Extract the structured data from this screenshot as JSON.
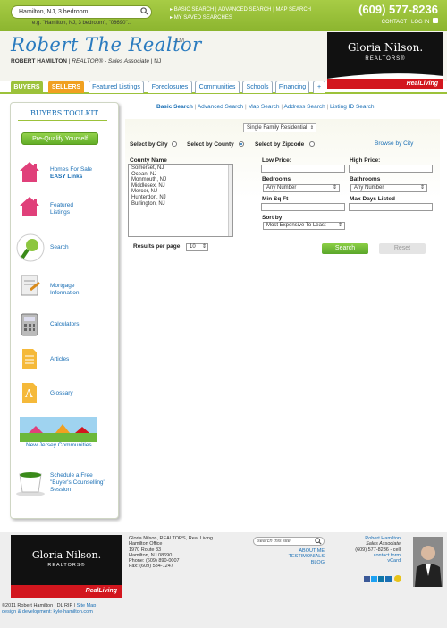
{
  "topbar": {
    "search_value": "Hamilton, NJ, 3 bedroom",
    "search_hint": "e.g. \"Hamilton, NJ, 3 bedroom\", \"08690\"...",
    "links": [
      "BASIC SEARCH",
      "ADVANCED SEARCH",
      "MAP SEARCH"
    ],
    "saved": "MY SAVED SEARCHES",
    "phone": "(609) 577-8236",
    "contact": "CONTACT",
    "login": "LOG IN"
  },
  "header": {
    "logo": "Robert The Realtor",
    "tm": "TM",
    "agent_name": "ROBERT HAMILTON",
    "agent_role": "REALTOR® - Sales Associate",
    "agent_state": "NJ",
    "brand_name": "Gloria Nilson.",
    "brand_sub": "REALTORS®",
    "brand_tag": "RealLiving"
  },
  "nav": {
    "tabs": [
      "BUYERS",
      "SELLERS",
      "Featured Listings",
      "Foreclosures",
      "Communities",
      "Schools",
      "Financing",
      "+"
    ]
  },
  "sidebar": {
    "title": "BUYERS TOOLKIT",
    "prequal": "Pre-Qualify Yourself",
    "items": [
      {
        "line1": "Homes For Sale",
        "line2": "EASY Links"
      },
      {
        "line1": "Featured",
        "line2": "Listings"
      },
      {
        "line1": "Search",
        "line2": ""
      },
      {
        "line1": "Mortgage",
        "line2": "Information"
      },
      {
        "line1": "Calculators",
        "line2": ""
      },
      {
        "line1": "Articles",
        "line2": ""
      },
      {
        "line1": "Glossary",
        "line2": ""
      },
      {
        "line1": "New Jersey Communities",
        "line2": ""
      },
      {
        "line1": "Schedule a Free",
        "line2": "\"Buyer's Counselling\"",
        "line3": "Session"
      }
    ]
  },
  "search": {
    "tabs": [
      "Basic Search",
      "Advanced Search",
      "Map Search",
      "Address Search",
      "Listing ID Search"
    ],
    "property_type": "Single Family Residential",
    "by_city": "Select by City",
    "by_county": "Select by County",
    "by_zip": "Select by Zipcode",
    "browse_city": "Browse by City",
    "county_label": "County Name",
    "counties": [
      "Somerset, NJ",
      "Ocean, NJ",
      "Monmouth, NJ",
      "Middlesex, NJ",
      "Mercer, NJ",
      "Hunterdon, NJ",
      "Burlington, NJ"
    ],
    "low_price": "Low Price:",
    "high_price": "High Price:",
    "bedrooms": "Bedrooms",
    "bedrooms_value": "Any Number",
    "bathrooms": "Bathrooms",
    "bathrooms_value": "Any Number",
    "min_sqft": "Min Sq Ft",
    "max_days": "Max Days Listed",
    "sort_by": "Sort by",
    "sort_value": "Most Expensive To Least",
    "results_label": "Results per page",
    "results_value": "10",
    "search_btn": "Search",
    "reset_btn": "Reset"
  },
  "footer": {
    "company": "Gloria Nilson, REALTORS, Real Living",
    "office": "Hamilton Office",
    "addr1": "1970 Route 33",
    "addr2": "Hamilton, NJ 08690",
    "phone": "Phone: (609) 890-0007",
    "fax": "Fax: (609) 584-1247",
    "search_placeholder": "search this site",
    "about": "ABOUT ME",
    "testimonials": "TESTIMONIALS",
    "blog": "BLOG",
    "agent": "Robert Hamilton",
    "agent_role": "Sales Associate",
    "cell": "(609) 577-8236 - cell",
    "contact_form": "contact form",
    "vcard": "vCard",
    "copyright": "©2011 Robert Hamilton",
    "dl": "DL RIP",
    "sitemap": "Site Map",
    "design": "design & development: kyle-hamilton.com"
  },
  "colors": {
    "green": "#9cc23a",
    "blue": "#1a6fb5",
    "orange": "#f0a020",
    "red": "#d2161e"
  }
}
